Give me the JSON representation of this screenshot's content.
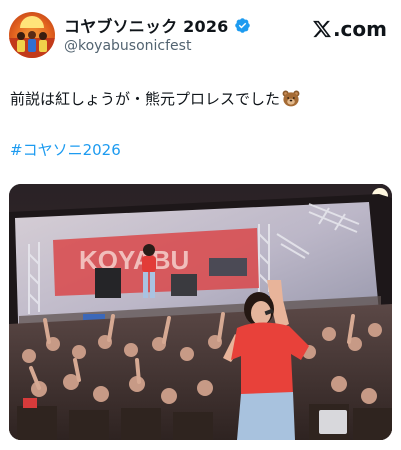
{
  "account": {
    "display_name": "コヤブソニック 2026",
    "handle": "@koyabusonicfest"
  },
  "brand": {
    "logo_text": ".com",
    "logo_icon": "x-logo-icon"
  },
  "tweet": {
    "text": "前説は紅しょうが・熊元プロレスでした",
    "emoji": "bear-face-icon",
    "hashtag": "#コヤソニ2026"
  },
  "photo": {
    "screen_text": "KOYABU"
  },
  "colors": {
    "link": "#1d9bf0",
    "verified": "#1d9bf0",
    "secondary_text": "#536471",
    "shirt": "#e8413a"
  }
}
